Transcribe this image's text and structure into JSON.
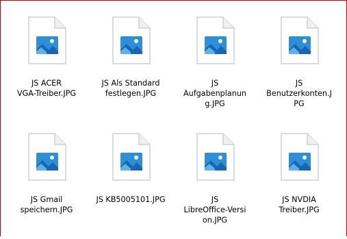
{
  "colors": {
    "border": "#c00000",
    "page_fold": "#d9d9d9",
    "image_bg": "#2e8fd6",
    "mountain_dark": "#1767b8",
    "mountain_light": "#5fb1ea"
  },
  "files": [
    {
      "name": "JS ACER\nVGA-Treiber.JPG",
      "icon": "jpg-file-icon"
    },
    {
      "name": "JS Als Standard\nfestlegen.JPG",
      "icon": "jpg-file-icon"
    },
    {
      "name": "JS\nAufgabenplanun\ng.JPG",
      "icon": "jpg-file-icon"
    },
    {
      "name": "JS\nBenutzerkonten.J\nPG",
      "icon": "jpg-file-icon"
    },
    {
      "name": "JS Gmail\nspeichern.JPG",
      "icon": "jpg-file-icon"
    },
    {
      "name": "JS KB5005101.JPG",
      "icon": "jpg-file-icon"
    },
    {
      "name": "JS\nLibreOffice-Versi\non.JPG",
      "icon": "jpg-file-icon"
    },
    {
      "name": "JS NVDIA\nTreiber.JPG",
      "icon": "jpg-file-icon"
    }
  ]
}
